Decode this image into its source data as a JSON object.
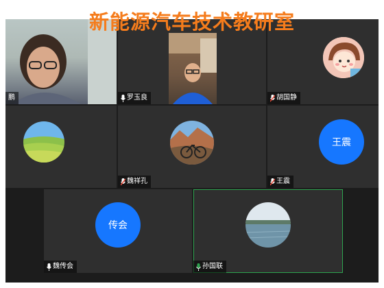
{
  "title": "新能源汽车技术教研室",
  "participants": [
    {
      "name": "鹏",
      "mic": "on"
    },
    {
      "name": "罗玉良",
      "mic": "on"
    },
    {
      "name": "胡国静",
      "mic": "muted"
    },
    {
      "name": "",
      "mic": "none"
    },
    {
      "name": "魏祥孔",
      "mic": "muted"
    },
    {
      "name": "王震",
      "mic": "muted",
      "avatar_text": "王震"
    },
    {
      "name": "魏传会",
      "mic": "on",
      "avatar_text": "传会"
    },
    {
      "name": "孙国联",
      "mic": "on",
      "active": true
    }
  ],
  "colors": {
    "title": "#f57c1c",
    "tile_bg": "#2f2f2f",
    "grid_bg": "#1c1c1c",
    "avatar_blue": "#1677ff",
    "active_border": "#2ea44f",
    "muted_red": "#e74c3c"
  }
}
